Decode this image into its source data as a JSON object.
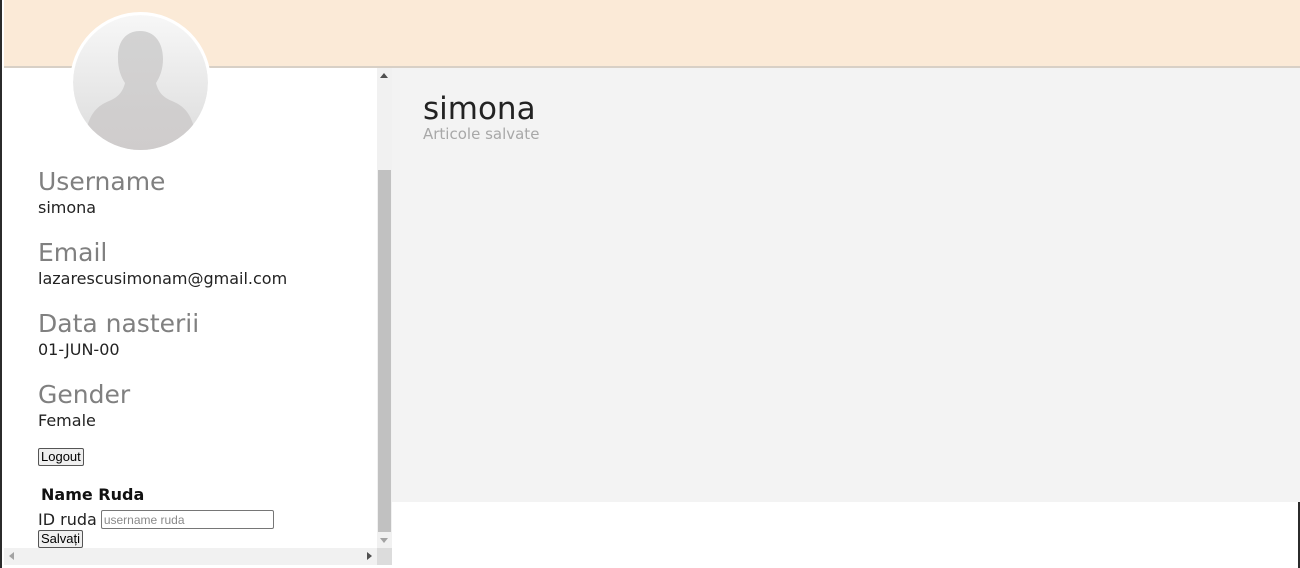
{
  "profile": {
    "avatar_icon": "user-silhouette-icon",
    "fields": [
      {
        "label": "Username",
        "value": "simona"
      },
      {
        "label": "Email",
        "value": "lazarescusimonam@gmail.com"
      },
      {
        "label": "Data nasterii",
        "value": "01-JUN-00"
      },
      {
        "label": "Gender",
        "value": "Female"
      }
    ],
    "logout_label": "Logout"
  },
  "ruda": {
    "title": "Name Ruda",
    "id_label": "ID ruda",
    "input_placeholder": "username ruda",
    "input_value": "",
    "save_label": "Salvați"
  },
  "main": {
    "title": "simona",
    "subtitle": "Articole salvate"
  },
  "colors": {
    "header_bg": "#fbead7",
    "main_bg": "#f3f3f3",
    "label_gray": "#808080"
  }
}
